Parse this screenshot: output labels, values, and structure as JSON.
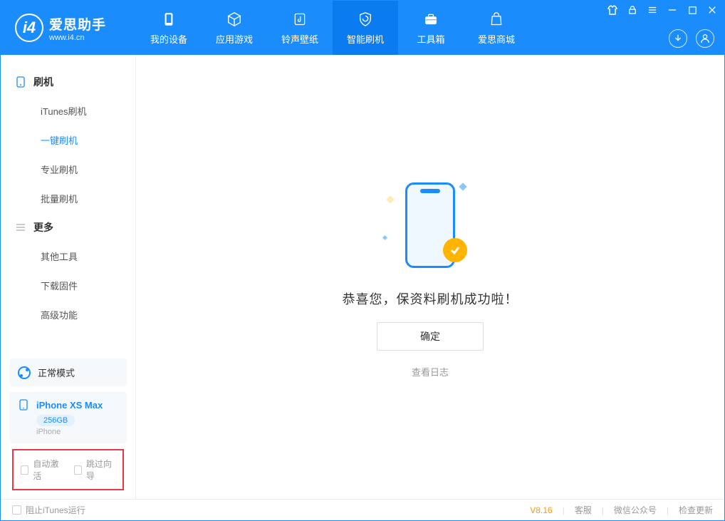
{
  "app": {
    "title": "爱思助手",
    "subtitle": "www.i4.cn"
  },
  "nav": {
    "device": "我的设备",
    "apps": "应用游戏",
    "ringtone": "铃声壁纸",
    "flash": "智能刷机",
    "toolbox": "工具箱",
    "store": "爱思商城"
  },
  "sidebar": {
    "flash_header": "刷机",
    "itunes_flash": "iTunes刷机",
    "oneclick_flash": "一键刷机",
    "pro_flash": "专业刷机",
    "batch_flash": "批量刷机",
    "more_header": "更多",
    "other_tools": "其他工具",
    "download_fw": "下载固件",
    "advanced": "高级功能"
  },
  "device": {
    "mode": "正常模式",
    "name": "iPhone XS Max",
    "capacity": "256GB",
    "type": "iPhone"
  },
  "checkboxes": {
    "auto_activate": "自动激活",
    "skip_guide": "跳过向导"
  },
  "main": {
    "success_message": "恭喜您，保资料刷机成功啦！",
    "confirm": "确定",
    "view_log": "查看日志"
  },
  "footer": {
    "block_itunes": "阻止iTunes运行",
    "version": "V8.16",
    "support": "客服",
    "wechat": "微信公众号",
    "check_update": "检查更新"
  }
}
